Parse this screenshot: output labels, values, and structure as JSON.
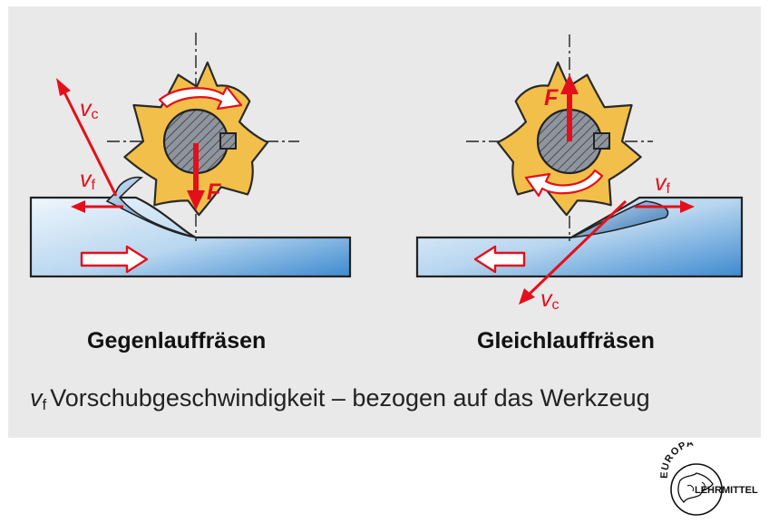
{
  "colors": {
    "panel": "#e9e9e9",
    "cutter": "#f1bf4a",
    "cutter_outline": "#2a2a2a",
    "workpiece_light": "#e6f1fa",
    "workpiece_dark": "#3d8ad0",
    "arrow": "#e3101b",
    "hub": "#8e959f"
  },
  "left": {
    "vc": {
      "sym": "v",
      "sub": "c"
    },
    "vf": {
      "sym": "v",
      "sub": "f"
    },
    "force": "F",
    "caption": "Gegenlauffräsen"
  },
  "right": {
    "vc": {
      "sym": "v",
      "sub": "c"
    },
    "vf": {
      "sym": "v",
      "sub": "f"
    },
    "force": "F",
    "caption": "Gleichlauffräsen"
  },
  "legend": {
    "sym": "v",
    "sub": "f",
    "text": "Vorschubgeschwindigkeit – bezogen auf das Werkzeug"
  },
  "logo": {
    "top": "EUROPA",
    "right": "LEHRMITTEL"
  }
}
